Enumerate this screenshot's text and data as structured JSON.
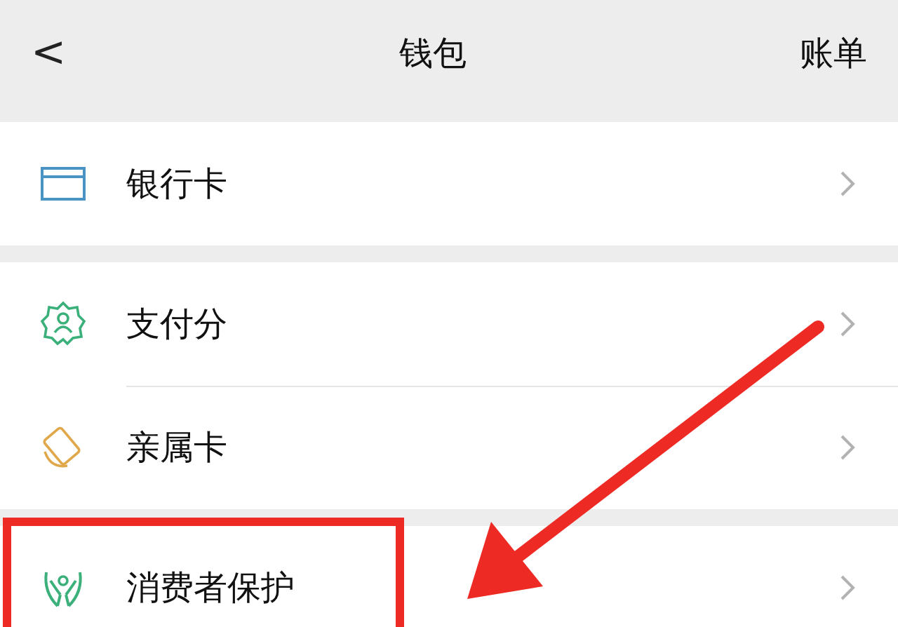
{
  "nav_bar": {
    "back": "<",
    "title": "钱包",
    "action": "账单"
  },
  "sections": [
    {
      "items": [
        {
          "kind": "bank_card",
          "label": "银行卡"
        }
      ]
    },
    {
      "items": [
        {
          "kind": "pay_score",
          "label": "支付分"
        },
        {
          "kind": "family_card",
          "label": "亲属卡"
        }
      ]
    },
    {
      "items": [
        {
          "kind": "consumer_protection",
          "label": "消费者保护"
        }
      ]
    }
  ]
}
